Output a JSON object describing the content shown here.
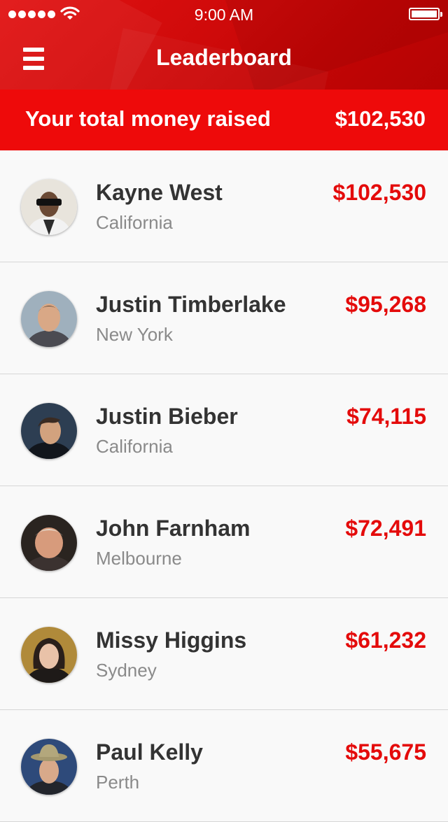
{
  "status_bar": {
    "time": "9:00 AM"
  },
  "nav": {
    "title": "Leaderboard"
  },
  "summary": {
    "label": "Your total money raised",
    "value": "$102,530"
  },
  "leaders": [
    {
      "name": "Kayne West",
      "location": "California",
      "amount": "$102,530"
    },
    {
      "name": "Justin Timberlake",
      "location": "New York",
      "amount": "$95,268"
    },
    {
      "name": "Justin Bieber",
      "location": "California",
      "amount": "$74,115"
    },
    {
      "name": "John Farnham",
      "location": "Melbourne",
      "amount": "$72,491"
    },
    {
      "name": "Missy Higgins",
      "location": "Sydney",
      "amount": "$61,232"
    },
    {
      "name": "Paul Kelly",
      "location": "Perth",
      "amount": "$55,675"
    }
  ],
  "colors": {
    "brand_red": "#ee0a0a",
    "amount_red": "#e40b0b",
    "name_text": "#333333",
    "location_text": "#8a8a8a"
  },
  "icons": {
    "menu": "hamburger-icon",
    "wifi": "wifi-icon",
    "battery": "battery-icon",
    "signal": "signal-icon"
  }
}
